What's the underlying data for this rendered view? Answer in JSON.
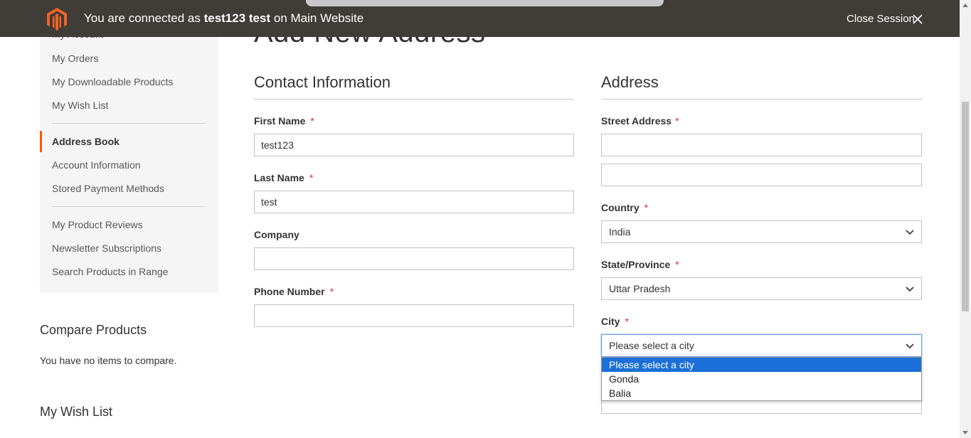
{
  "admin_bar": {
    "message_prefix": "You are connected as",
    "user": "test123 test",
    "message_suffix": "on Main Website",
    "close_label": "Close Session"
  },
  "page": {
    "title": "Add New Address"
  },
  "sidebar": {
    "items": [
      {
        "label": "My Account"
      },
      {
        "label": "My Orders"
      },
      {
        "label": "My Downloadable Products"
      },
      {
        "label": "My Wish List"
      },
      {
        "label": "Address Book",
        "active": true
      },
      {
        "label": "Account Information"
      },
      {
        "label": "Stored Payment Methods"
      },
      {
        "label": "My Product Reviews"
      },
      {
        "label": "Newsletter Subscriptions"
      },
      {
        "label": "Search Products in Range"
      }
    ]
  },
  "compare": {
    "title": "Compare Products",
    "empty_text": "You have no items to compare."
  },
  "wishlist_block": {
    "title": "My Wish List"
  },
  "contact": {
    "legend": "Contact Information",
    "first_name_label": "First Name",
    "first_name_value": "test123",
    "last_name_label": "Last Name",
    "last_name_value": "test",
    "company_label": "Company",
    "company_value": "",
    "phone_label": "Phone Number",
    "phone_value": ""
  },
  "address": {
    "legend": "Address",
    "street_label": "Street Address",
    "street_line1": "",
    "street_line2": "",
    "country_label": "Country",
    "country_value": "India",
    "state_label": "State/Province",
    "state_value": "Uttar Pradesh",
    "city_label": "City",
    "city_value": "Please select a city",
    "city_options": [
      "Please select a city",
      "Gonda",
      "Balia"
    ]
  },
  "required_marker": "*",
  "colors": {
    "admin_bar": "#403c38",
    "active_accent": "#ff5501",
    "required": "#e02b27",
    "option_highlight": "#1a6fd8"
  }
}
